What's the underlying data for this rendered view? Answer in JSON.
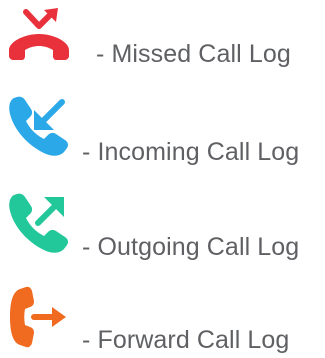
{
  "legend": {
    "items": [
      {
        "label": "- Missed Call Log",
        "icon": "missed-call-icon",
        "color": "#e8313b"
      },
      {
        "label": "- Incoming Call Log",
        "icon": "incoming-call-icon",
        "color": "#2aa8e8"
      },
      {
        "label": "- Outgoing Call Log",
        "icon": "outgoing-call-icon",
        "color": "#22c79a"
      },
      {
        "label": "- Forward Call Log",
        "icon": "forward-call-icon",
        "color": "#f06a1f"
      }
    ]
  }
}
